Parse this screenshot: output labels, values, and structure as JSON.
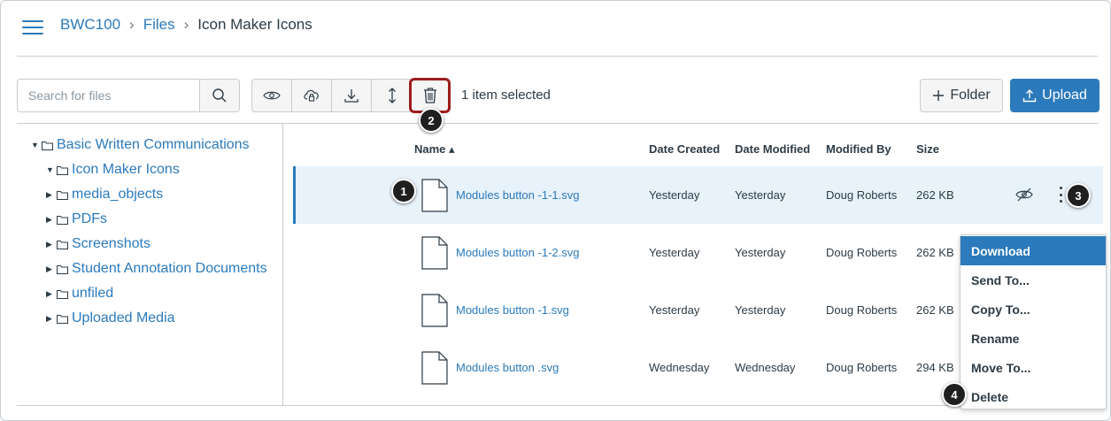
{
  "breadcrumb": {
    "course": "BWC100",
    "section": "Files",
    "current": "Icon Maker Icons",
    "separator": "›"
  },
  "search": {
    "placeholder": "Search for files"
  },
  "toolbar": {
    "selected_text": "1 item selected",
    "folder_label": "Folder",
    "upload_label": "Upload",
    "icons": [
      "eye-icon",
      "cloud-lock-icon",
      "download-icon",
      "move-icon",
      "trash-icon"
    ]
  },
  "tree": [
    {
      "label": "Basic Written Communications",
      "expanded": true,
      "level": 0
    },
    {
      "label": "Icon Maker Icons",
      "expanded": true,
      "level": 1
    },
    {
      "label": "media_objects",
      "expanded": false,
      "level": 1
    },
    {
      "label": "PDFs",
      "expanded": false,
      "level": 1
    },
    {
      "label": "Screenshots",
      "expanded": false,
      "level": 1
    },
    {
      "label": "Student Annotation Documents",
      "expanded": false,
      "level": 1
    },
    {
      "label": "unfiled",
      "expanded": false,
      "level": 1
    },
    {
      "label": "Uploaded Media",
      "expanded": false,
      "level": 1
    }
  ],
  "table": {
    "headers": {
      "name": "Name ▴",
      "created": "Date Created",
      "modified": "Date Modified",
      "modified_by": "Modified By",
      "size": "Size"
    },
    "rows": [
      {
        "name": "Modules button -1-1.svg",
        "created": "Yesterday",
        "modified": "Yesterday",
        "modified_by": "Doug Roberts",
        "size": "262 KB",
        "selected": true
      },
      {
        "name": "Modules button -1-2.svg",
        "created": "Yesterday",
        "modified": "Yesterday",
        "modified_by": "Doug Roberts",
        "size": "262 KB",
        "selected": false
      },
      {
        "name": "Modules button -1.svg",
        "created": "Yesterday",
        "modified": "Yesterday",
        "modified_by": "Doug Roberts",
        "size": "262 KB",
        "selected": false
      },
      {
        "name": "Modules button .svg",
        "created": "Wednesday",
        "modified": "Wednesday",
        "modified_by": "Doug Roberts",
        "size": "294 KB",
        "selected": false
      }
    ]
  },
  "menu": {
    "items": [
      "Download",
      "Send To...",
      "Copy To...",
      "Rename",
      "Move To...",
      "Delete"
    ],
    "active_index": 0
  },
  "callouts": [
    "1",
    "2",
    "3",
    "4"
  ],
  "colors": {
    "accent": "#2b7abc",
    "selected_row": "#e8f2fb",
    "highlight_border": "#9c1c1c",
    "text": "#2d3b45"
  }
}
